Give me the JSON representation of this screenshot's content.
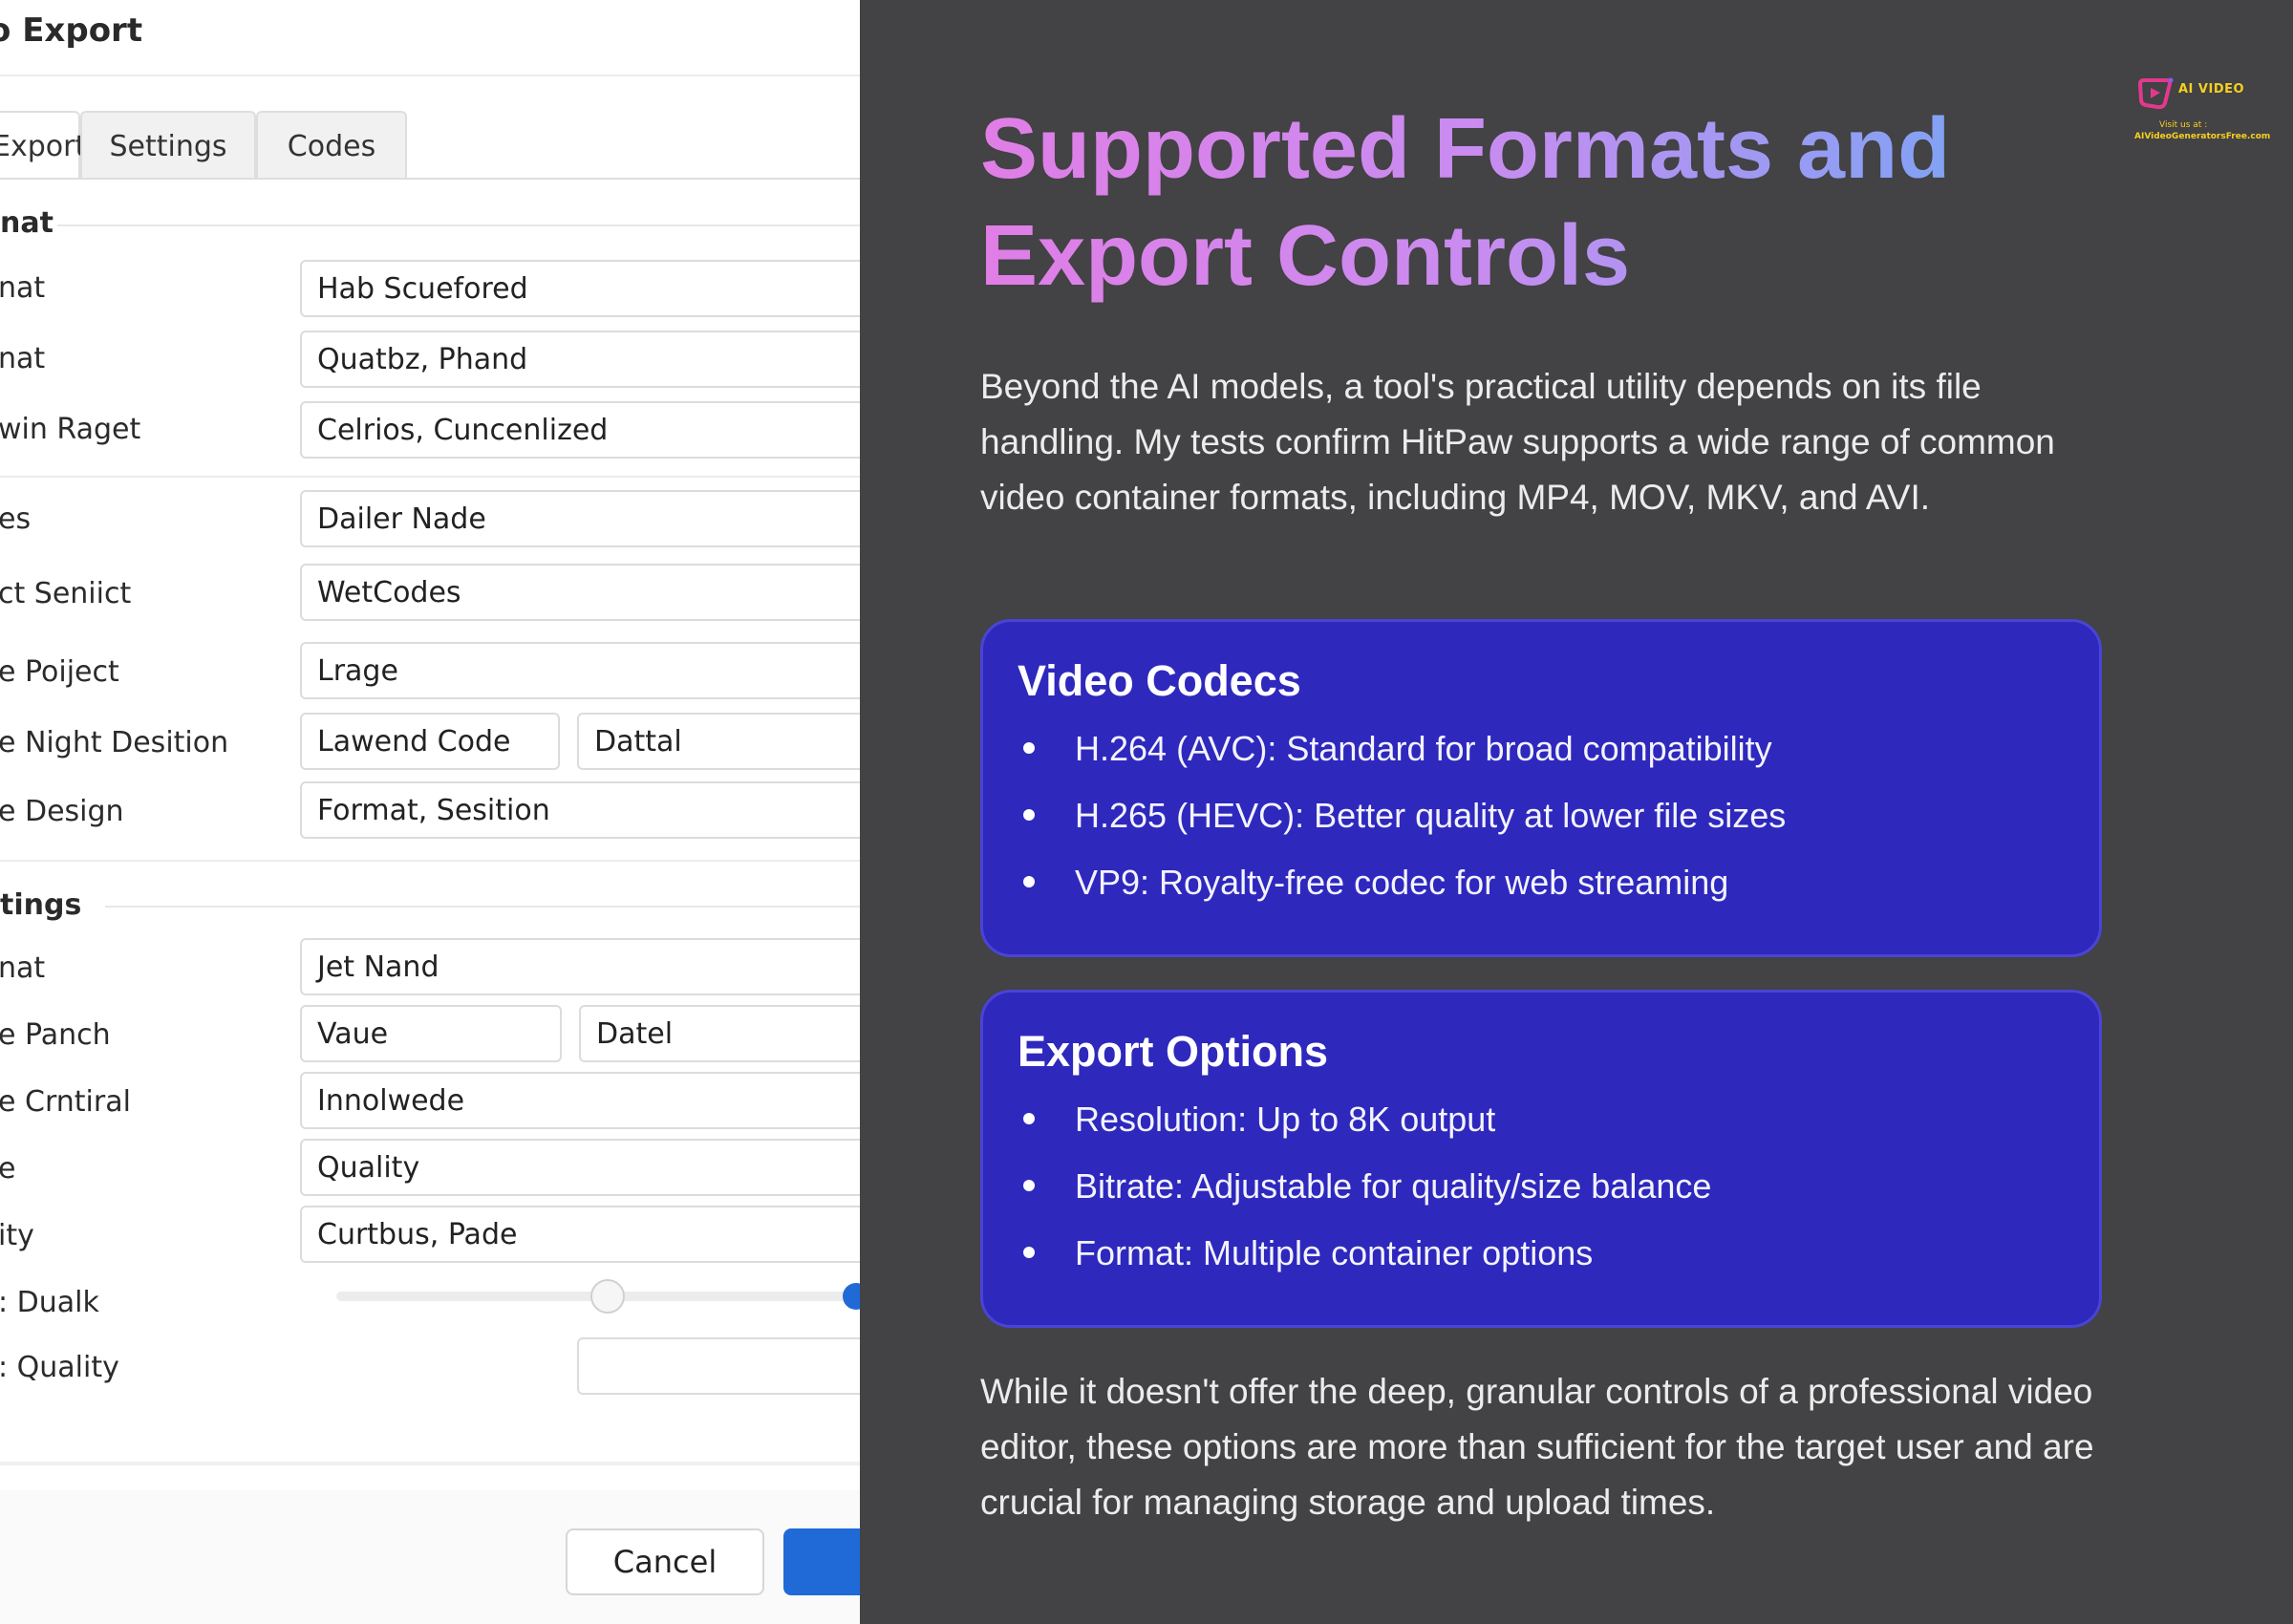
{
  "dialog": {
    "title": "o Export",
    "tabs": [
      "Export",
      "Settings",
      "Codes"
    ],
    "section1": "nat",
    "section2": "tings",
    "rows": [
      {
        "label": "nat",
        "value": "Hab Scuefored"
      },
      {
        "label": "nat",
        "value": "Quatbz, Phand"
      },
      {
        "label": "win Raget",
        "value": "Celrios, Cuncenlized"
      },
      {
        "label": "es",
        "value": "Dailer Nade"
      },
      {
        "label": "ct Seniict",
        "value": "WetCodes"
      },
      {
        "label": "e Poiject",
        "value": "Lrage"
      },
      {
        "label": "e Night Desition",
        "value": "Lawend Code",
        "value2": "Dattal"
      },
      {
        "label": "e Design",
        "value": "Format, Sesition"
      },
      {
        "label": "nat",
        "value": "Jet Nand"
      },
      {
        "label": "e Panch",
        "value": "Vaue",
        "value2": "Datel"
      },
      {
        "label": "e Crntiral",
        "value": "Innolwede"
      },
      {
        "label": "e",
        "value": "Quality"
      },
      {
        "label": "ity",
        "value": "Curtbus, Pade"
      },
      {
        "label": ": Dualk"
      },
      {
        "label": ": Quality",
        "value": ""
      }
    ],
    "slider_value": 0.5,
    "cancel_label": "Cancel"
  },
  "article": {
    "heading": "Supported Formats and Export Controls",
    "intro": "Beyond the AI models, a tool's practical utility depends on its file handling. My tests confirm HitPaw supports a wide range of common video container formats, including MP4, MOV, MKV, and AVI.",
    "cards": [
      {
        "title": "Video Codecs",
        "items": [
          "H.264 (AVC): Standard for broad compatibility",
          "H.265 (HEVC): Better quality at lower file sizes",
          "VP9: Royalty-free codec for web streaming"
        ]
      },
      {
        "title": "Export Options",
        "items": [
          "Resolution: Up to 8K output",
          "Bitrate: Adjustable for quality/size balance",
          "Format: Multiple container options"
        ]
      }
    ],
    "outro": "While it doesn't offer the deep, granular controls of a professional video editor, these options are more than sufficient for the target user and are crucial for managing storage and upload times."
  },
  "logo": {
    "name": "AI VIDEO",
    "visit": "Visit us at :",
    "url": "AIVideoGeneratorsFree.com"
  },
  "colors": {
    "panel_bg": "#434244",
    "card_bg": "#2e28bd",
    "heading_gradient_start": "#e07ee6",
    "heading_gradient_end": "#6fa8f5",
    "primary_button": "#1f6ad6"
  }
}
